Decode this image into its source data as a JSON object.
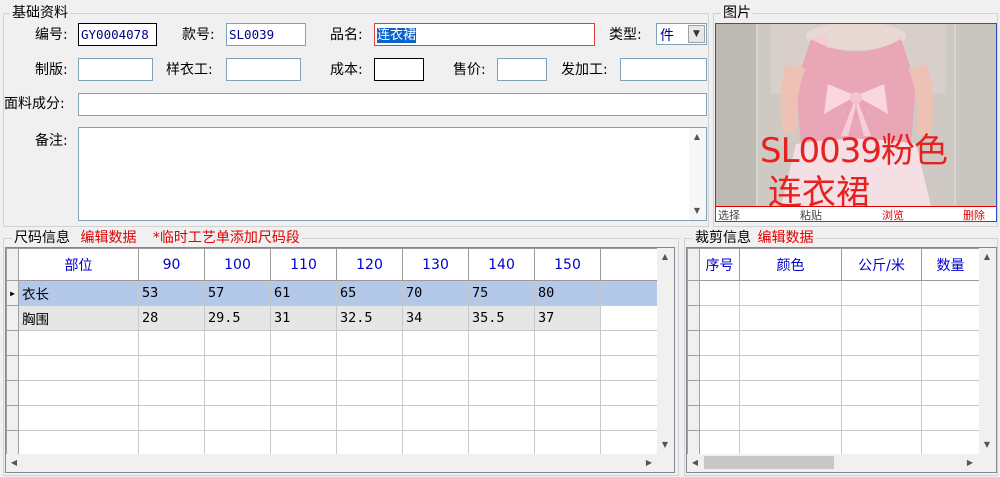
{
  "basic": {
    "legend": "基础资料",
    "fields": {
      "code_label": "编号:",
      "code_value": "GY0004078",
      "style_label": "款号:",
      "style_value": "SL0039",
      "name_label": "品名:",
      "name_value": "连衣裙",
      "type_label": "类型:",
      "type_value": "件",
      "plate_label": "制版:",
      "plate_value": "",
      "sample_label": "样衣工:",
      "sample_value": "",
      "cost_label": "成本:",
      "cost_value": "",
      "price_label": "售价:",
      "price_value": "",
      "send_label": "发加工:",
      "send_value": "",
      "fabric_label": "面料成分:",
      "fabric_value": "",
      "note_label": "备注:",
      "note_value": ""
    }
  },
  "picture": {
    "legend": "图片",
    "overlay_line1": "SL0039粉色",
    "overlay_line2": "连衣裙",
    "actions": [
      "选择",
      "粘贴",
      "浏览",
      "删除"
    ]
  },
  "size": {
    "legend": "尺码信息",
    "edit_link": "编辑数据",
    "temp_link": "*临时工艺单添加尺码段",
    "columns": [
      "部位",
      "90",
      "100",
      "110",
      "120",
      "130",
      "140",
      "150"
    ],
    "rows": [
      [
        "衣长",
        "53",
        "57",
        "61",
        "65",
        "70",
        "75",
        "80"
      ],
      [
        "胸围",
        "28",
        "29.5",
        "31",
        "32.5",
        "34",
        "35.5",
        "37"
      ]
    ]
  },
  "cut": {
    "legend": "裁剪信息",
    "edit_link": "编辑数据",
    "columns": [
      "序号",
      "颜色",
      "公斤/米",
      "数量"
    ]
  },
  "colors": {
    "accent_red": "#e00000",
    "header_blue": "#0000cc",
    "selection": "#b4c9ea"
  }
}
